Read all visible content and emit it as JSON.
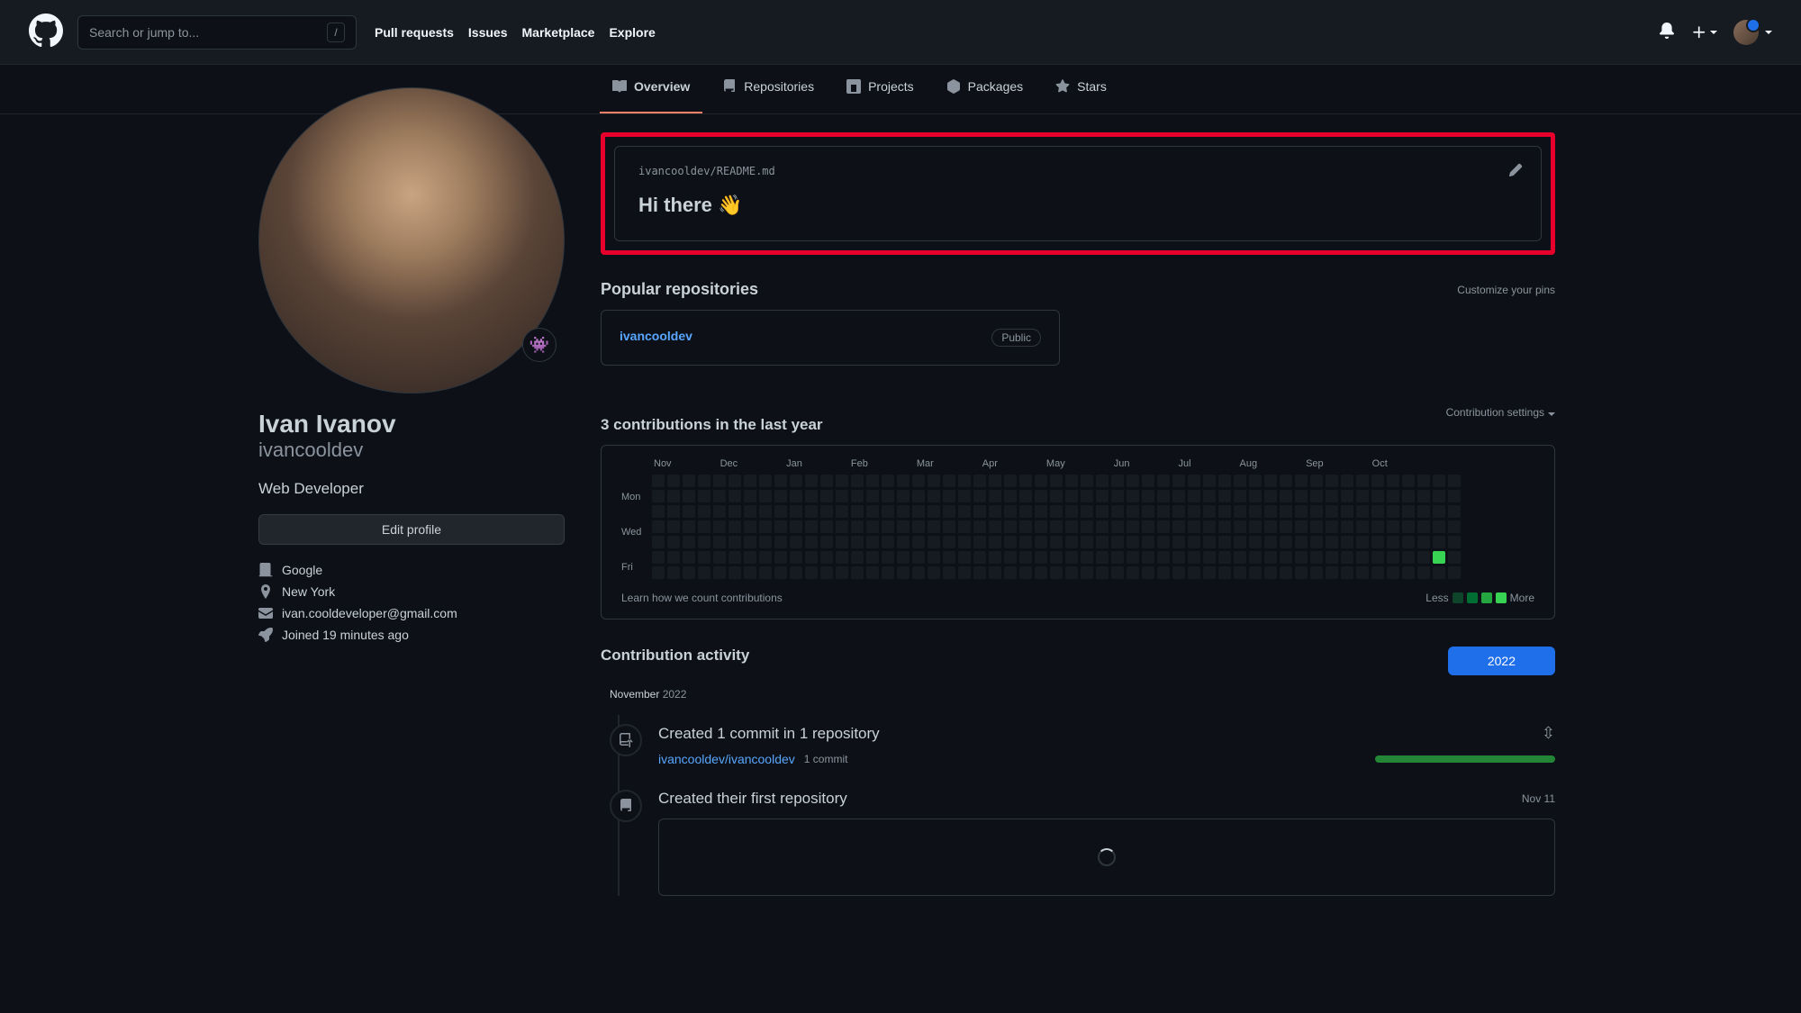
{
  "header": {
    "search_placeholder": "Search or jump to...",
    "slash_key": "/",
    "nav": {
      "pulls": "Pull requests",
      "issues": "Issues",
      "marketplace": "Marketplace",
      "explore": "Explore"
    }
  },
  "tabs": {
    "overview": "Overview",
    "repositories": "Repositories",
    "projects": "Projects",
    "packages": "Packages",
    "stars": "Stars"
  },
  "profile": {
    "name": "Ivan Ivanov",
    "login": "ivancooldev",
    "bio": "Web Developer",
    "edit_btn": "Edit profile",
    "emoji": "👾",
    "company": "Google",
    "location": "New York",
    "email": "ivan.cooldeveloper@gmail.com",
    "joined": "Joined 19 minutes ago"
  },
  "readme": {
    "path_user": "ivancooldev",
    "path_sep": "/",
    "path_file": "README",
    "path_ext": ".md",
    "heading": "Hi there 👋"
  },
  "popular": {
    "title": "Popular repositories",
    "customize": "Customize your pins",
    "repos": [
      {
        "name": "ivancooldev",
        "visibility": "Public"
      }
    ]
  },
  "contributions": {
    "title": "3 contributions in the last year",
    "settings": "Contribution settings",
    "months": [
      "Nov",
      "Dec",
      "Jan",
      "Feb",
      "Mar",
      "Apr",
      "May",
      "Jun",
      "Jul",
      "Aug",
      "Sep",
      "Oct"
    ],
    "days": [
      "Mon",
      "Wed",
      "Fri"
    ],
    "learn": "Learn how we count contributions",
    "less": "Less",
    "more": "More"
  },
  "activity": {
    "title": "Contribution activity",
    "year": "2022",
    "month": "November",
    "month_year": "2022",
    "item1": {
      "title": "Created 1 commit in 1 repository",
      "link": "ivancooldev/ivancooldev",
      "sub": "1 commit"
    },
    "item2": {
      "title": "Created their first repository",
      "date": "Nov 11"
    }
  }
}
